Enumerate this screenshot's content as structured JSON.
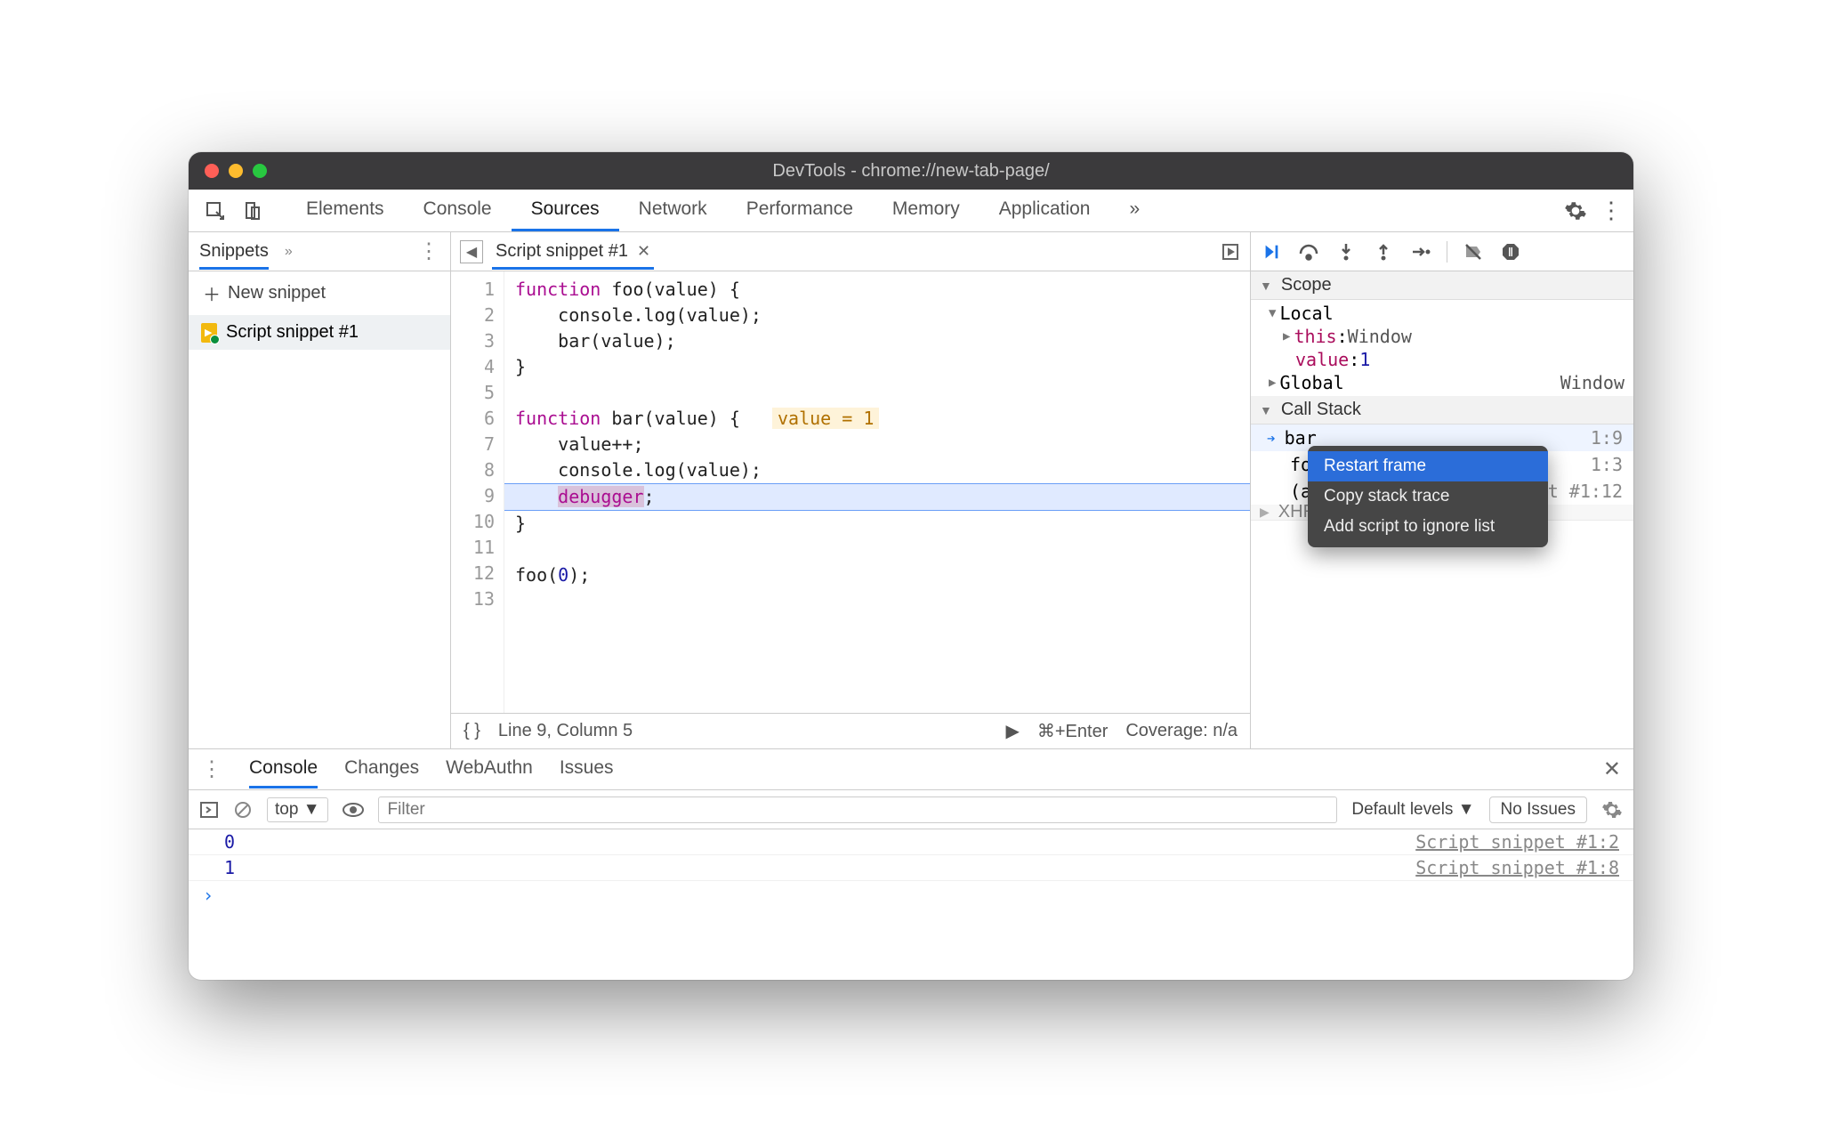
{
  "window": {
    "title": "DevTools - chrome://new-tab-page/"
  },
  "toolbar_tabs": {
    "elements": "Elements",
    "console": "Console",
    "sources": "Sources",
    "network": "Network",
    "performance": "Performance",
    "memory": "Memory",
    "application": "Application"
  },
  "left": {
    "snippets_label": "Snippets",
    "new_snippet": "New snippet",
    "items": [
      {
        "name": "Script snippet #1"
      }
    ]
  },
  "editor": {
    "file_tab": "Script snippet #1",
    "lines": [
      "function foo(value) {",
      "    console.log(value);",
      "    bar(value);",
      "}",
      "",
      "function bar(value) {",
      "    value++;",
      "    console.log(value);",
      "    debugger;",
      "}",
      "",
      "foo(0);",
      ""
    ],
    "hint_text": "value = 1",
    "status": {
      "cursor": "Line 9, Column 5",
      "run_hint": "⌘+Enter",
      "coverage": "Coverage: n/a"
    }
  },
  "debug": {
    "sections": {
      "scope": "Scope",
      "local": "Local",
      "this_label": "this",
      "this_value": "Window",
      "value_label": "value",
      "value_value": "1",
      "global": "Global",
      "global_value": "Window",
      "callstack": "Call Stack",
      "xhr": "XHR/fetch Breakpoints"
    },
    "callstack": [
      {
        "name": "bar",
        "loc": "1:9",
        "active": true
      },
      {
        "name": "foo",
        "loc": "1:3",
        "active": false
      },
      {
        "name": "(anon",
        "loc": "Script snippet #1:12",
        "active": false
      }
    ],
    "context_menu": {
      "restart": "Restart frame",
      "copy": "Copy stack trace",
      "ignore": "Add script to ignore list"
    }
  },
  "drawer": {
    "tabs": {
      "console": "Console",
      "changes": "Changes",
      "webauthn": "WebAuthn",
      "issues": "Issues"
    },
    "console": {
      "context": "top",
      "filter_placeholder": "Filter",
      "levels": "Default levels",
      "no_issues": "No Issues",
      "logs": [
        {
          "value": "0",
          "src": "Script snippet #1:2"
        },
        {
          "value": "1",
          "src": "Script snippet #1:8"
        }
      ]
    }
  }
}
